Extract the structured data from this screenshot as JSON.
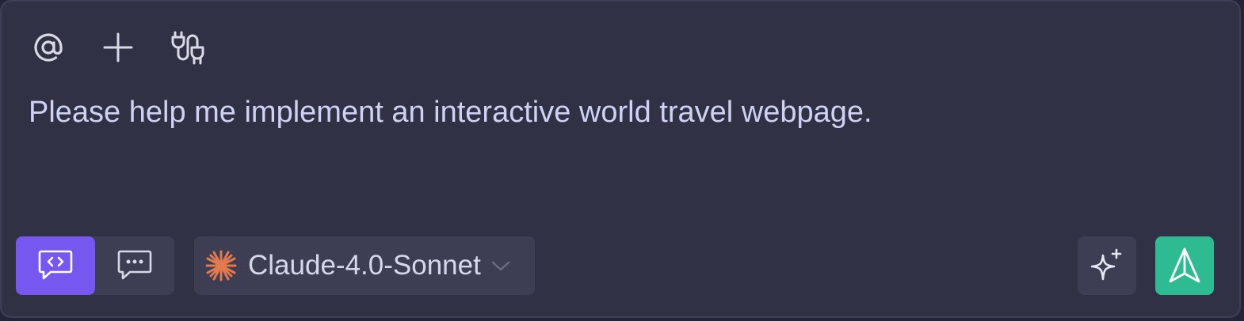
{
  "toolbar": {
    "icons": [
      "at-mention-icon",
      "plus-icon",
      "plug-icon"
    ]
  },
  "prompt": {
    "value": "Please help me implement an interactive world travel webpage."
  },
  "mode_toggle": {
    "options": [
      {
        "name": "code-mode",
        "icon": "code-chat-icon",
        "active": true
      },
      {
        "name": "chat-mode",
        "icon": "chat-ellipsis-icon",
        "active": false
      }
    ]
  },
  "model": {
    "selected": "Claude-4.0-Sonnet",
    "icon": "claude-sunburst-icon",
    "icon_color": "#e27a4e"
  },
  "actions": {
    "enhance_icon": "sparkle-icon",
    "send_icon": "send-icon"
  },
  "colors": {
    "background": "#303145",
    "accent": "#7657f0",
    "send": "#2fbb92"
  }
}
